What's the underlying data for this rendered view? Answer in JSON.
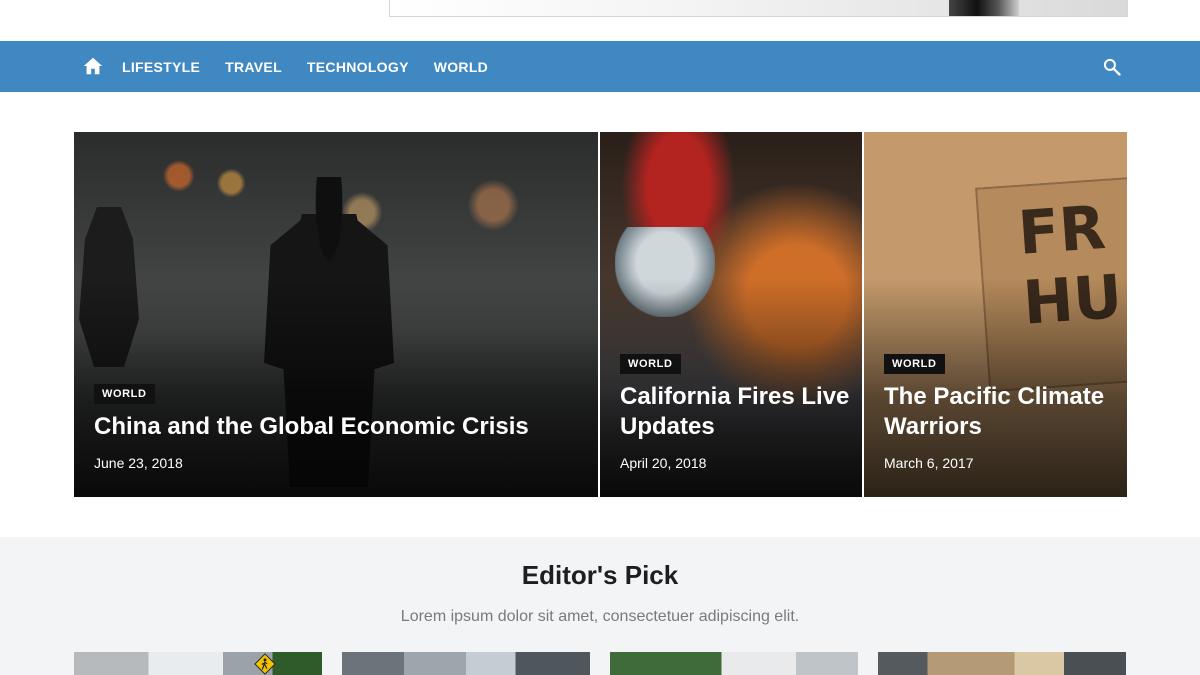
{
  "nav": {
    "home_icon": "home-icon",
    "links": [
      "LIFESTYLE",
      "TRAVEL",
      "TECHNOLOGY",
      "WORLD"
    ],
    "search_icon": "search-icon",
    "background_color": "#4088c2"
  },
  "featured": [
    {
      "category": "WORLD",
      "title": "China and the Global Economic Crisis",
      "date": "June 23, 2018"
    },
    {
      "category": "WORLD",
      "title": "California Fires Live Updates",
      "date": "April 20, 2018"
    },
    {
      "category": "WORLD",
      "title": "The Pacific Climate Warriors",
      "date": "March 6, 2017"
    }
  ],
  "sign_text": [
    "FR",
    "HU"
  ],
  "editors_pick": {
    "title": "Editor's Pick",
    "subtitle": "Lorem ipsum dolor sit amet, consectetuer adipiscing elit."
  }
}
